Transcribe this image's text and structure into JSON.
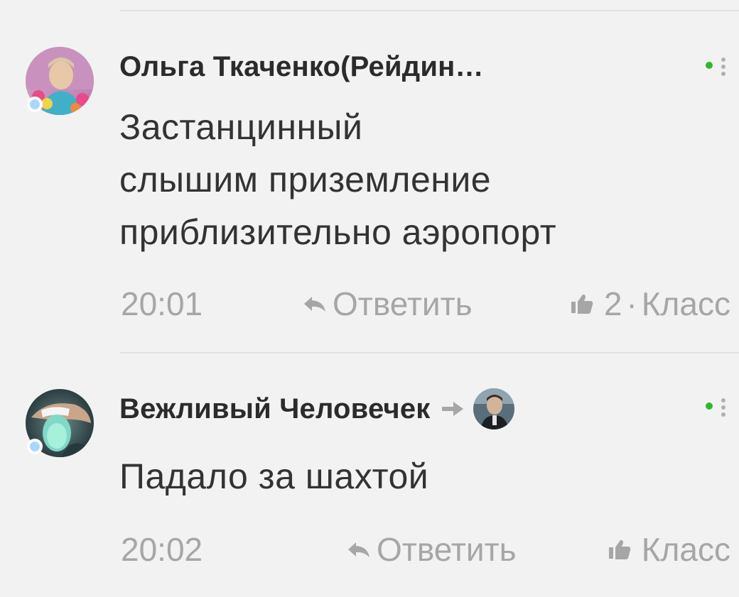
{
  "comments": [
    {
      "author": "Ольга Ткаченко(Рейдин…",
      "text_lines": [
        "Застанцинный",
        "слышим приземление",
        "приблизительно аэропорт"
      ],
      "time": "20:01",
      "reply_label": "Ответить",
      "like_count": "2",
      "like_label": "Класс",
      "separator": "·"
    },
    {
      "author": "Вежливый Человечек",
      "text_lines": [
        "Падало за шахтой"
      ],
      "time": "20:02",
      "reply_label": "Ответить",
      "like_label": "Класс"
    }
  ],
  "icons": {
    "menu": "more-vertical-icon",
    "reply": "reply-arrow-icon",
    "like": "thumbs-up-icon",
    "reply_to": "arrow-right-icon"
  },
  "colors": {
    "background": "#f2f2f2",
    "online_green": "#2db82d",
    "presence_dot": "#a9d7ff",
    "meta_gray": "#a6a6a6",
    "author_text": "#2b2b2b"
  }
}
